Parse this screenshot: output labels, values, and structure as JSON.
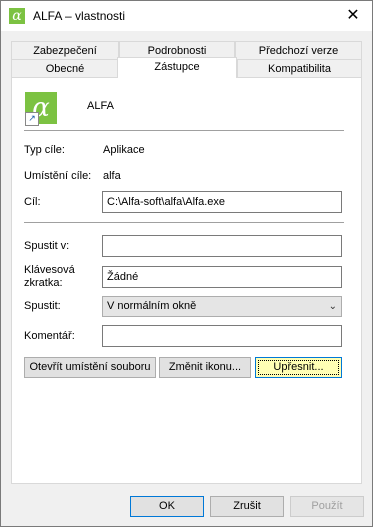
{
  "window": {
    "title": "ALFA – vlastnosti",
    "close_glyph": "✕",
    "icon_glyph": "α"
  },
  "tabs": {
    "row1": [
      "Zabezpečení",
      "Podrobnosti",
      "Předchozí verze"
    ],
    "row2": [
      "Obecné",
      "Zástupce",
      "Kompatibilita"
    ],
    "active": "Zástupce"
  },
  "shortcut": {
    "name": "ALFA",
    "icon_glyph": "α",
    "arrow_glyph": "↗",
    "target_type_label": "Typ cíle:",
    "target_type": "Aplikace",
    "target_location_label": "Umístění cíle:",
    "target_location": "alfa",
    "target_label": "Cíl:",
    "target": "C:\\Alfa-soft\\alfa\\Alfa.exe",
    "start_in_label": "Spustit v:",
    "start_in": "",
    "hotkey_label_1": "Klávesová",
    "hotkey_label_2": "zkratka:",
    "hotkey": "Žádné",
    "run_label": "Spustit:",
    "run": "V normálním okně",
    "comment_label": "Komentář:",
    "comment": ""
  },
  "buttons": {
    "open_location": "Otevřít umístění souboru",
    "change_icon": "Změnit ikonu...",
    "advanced": "Upřesnit...",
    "ok": "OK",
    "cancel": "Zrušit",
    "apply": "Použít"
  },
  "colors": {
    "accent": "#0078d7",
    "icon_green": "#7cc242",
    "focus_button": "#ffffb5"
  }
}
